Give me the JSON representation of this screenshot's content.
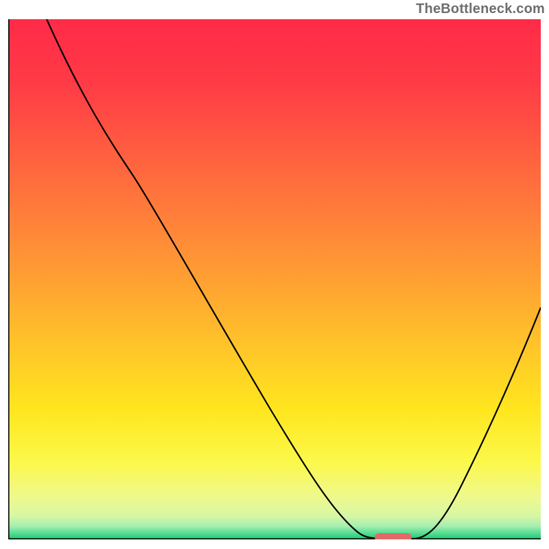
{
  "watermark": "TheBottleneck.com",
  "chart_data": {
    "type": "line",
    "title": "",
    "xlabel": "",
    "ylabel": "",
    "xlim": [
      0,
      100
    ],
    "ylim": [
      0,
      100
    ],
    "grid": false,
    "series": [
      {
        "name": "bottleneck-curve",
        "x": [
          7,
          14,
          20,
          27,
          35,
          43,
          50,
          56,
          62,
          67,
          70,
          73,
          76,
          80,
          85,
          90,
          95,
          100
        ],
        "y": [
          100,
          87,
          76,
          67,
          54,
          41,
          30,
          20,
          11,
          4,
          1,
          0,
          0,
          1,
          10,
          21,
          33,
          45
        ]
      }
    ],
    "annotations": [
      {
        "name": "optimal-marker",
        "shape": "rounded-bar",
        "x_range": [
          69,
          76
        ],
        "y": 0,
        "color": "#e06a68"
      }
    ],
    "background_gradient_stops": [
      {
        "pos": 0.0,
        "color": "#ff2b48"
      },
      {
        "pos": 0.3,
        "color": "#ff6a3e"
      },
      {
        "pos": 0.62,
        "color": "#ffc22a"
      },
      {
        "pos": 0.85,
        "color": "#fcf84a"
      },
      {
        "pos": 0.97,
        "color": "#a3efb0"
      },
      {
        "pos": 1.0,
        "color": "#12cf6f"
      }
    ]
  }
}
